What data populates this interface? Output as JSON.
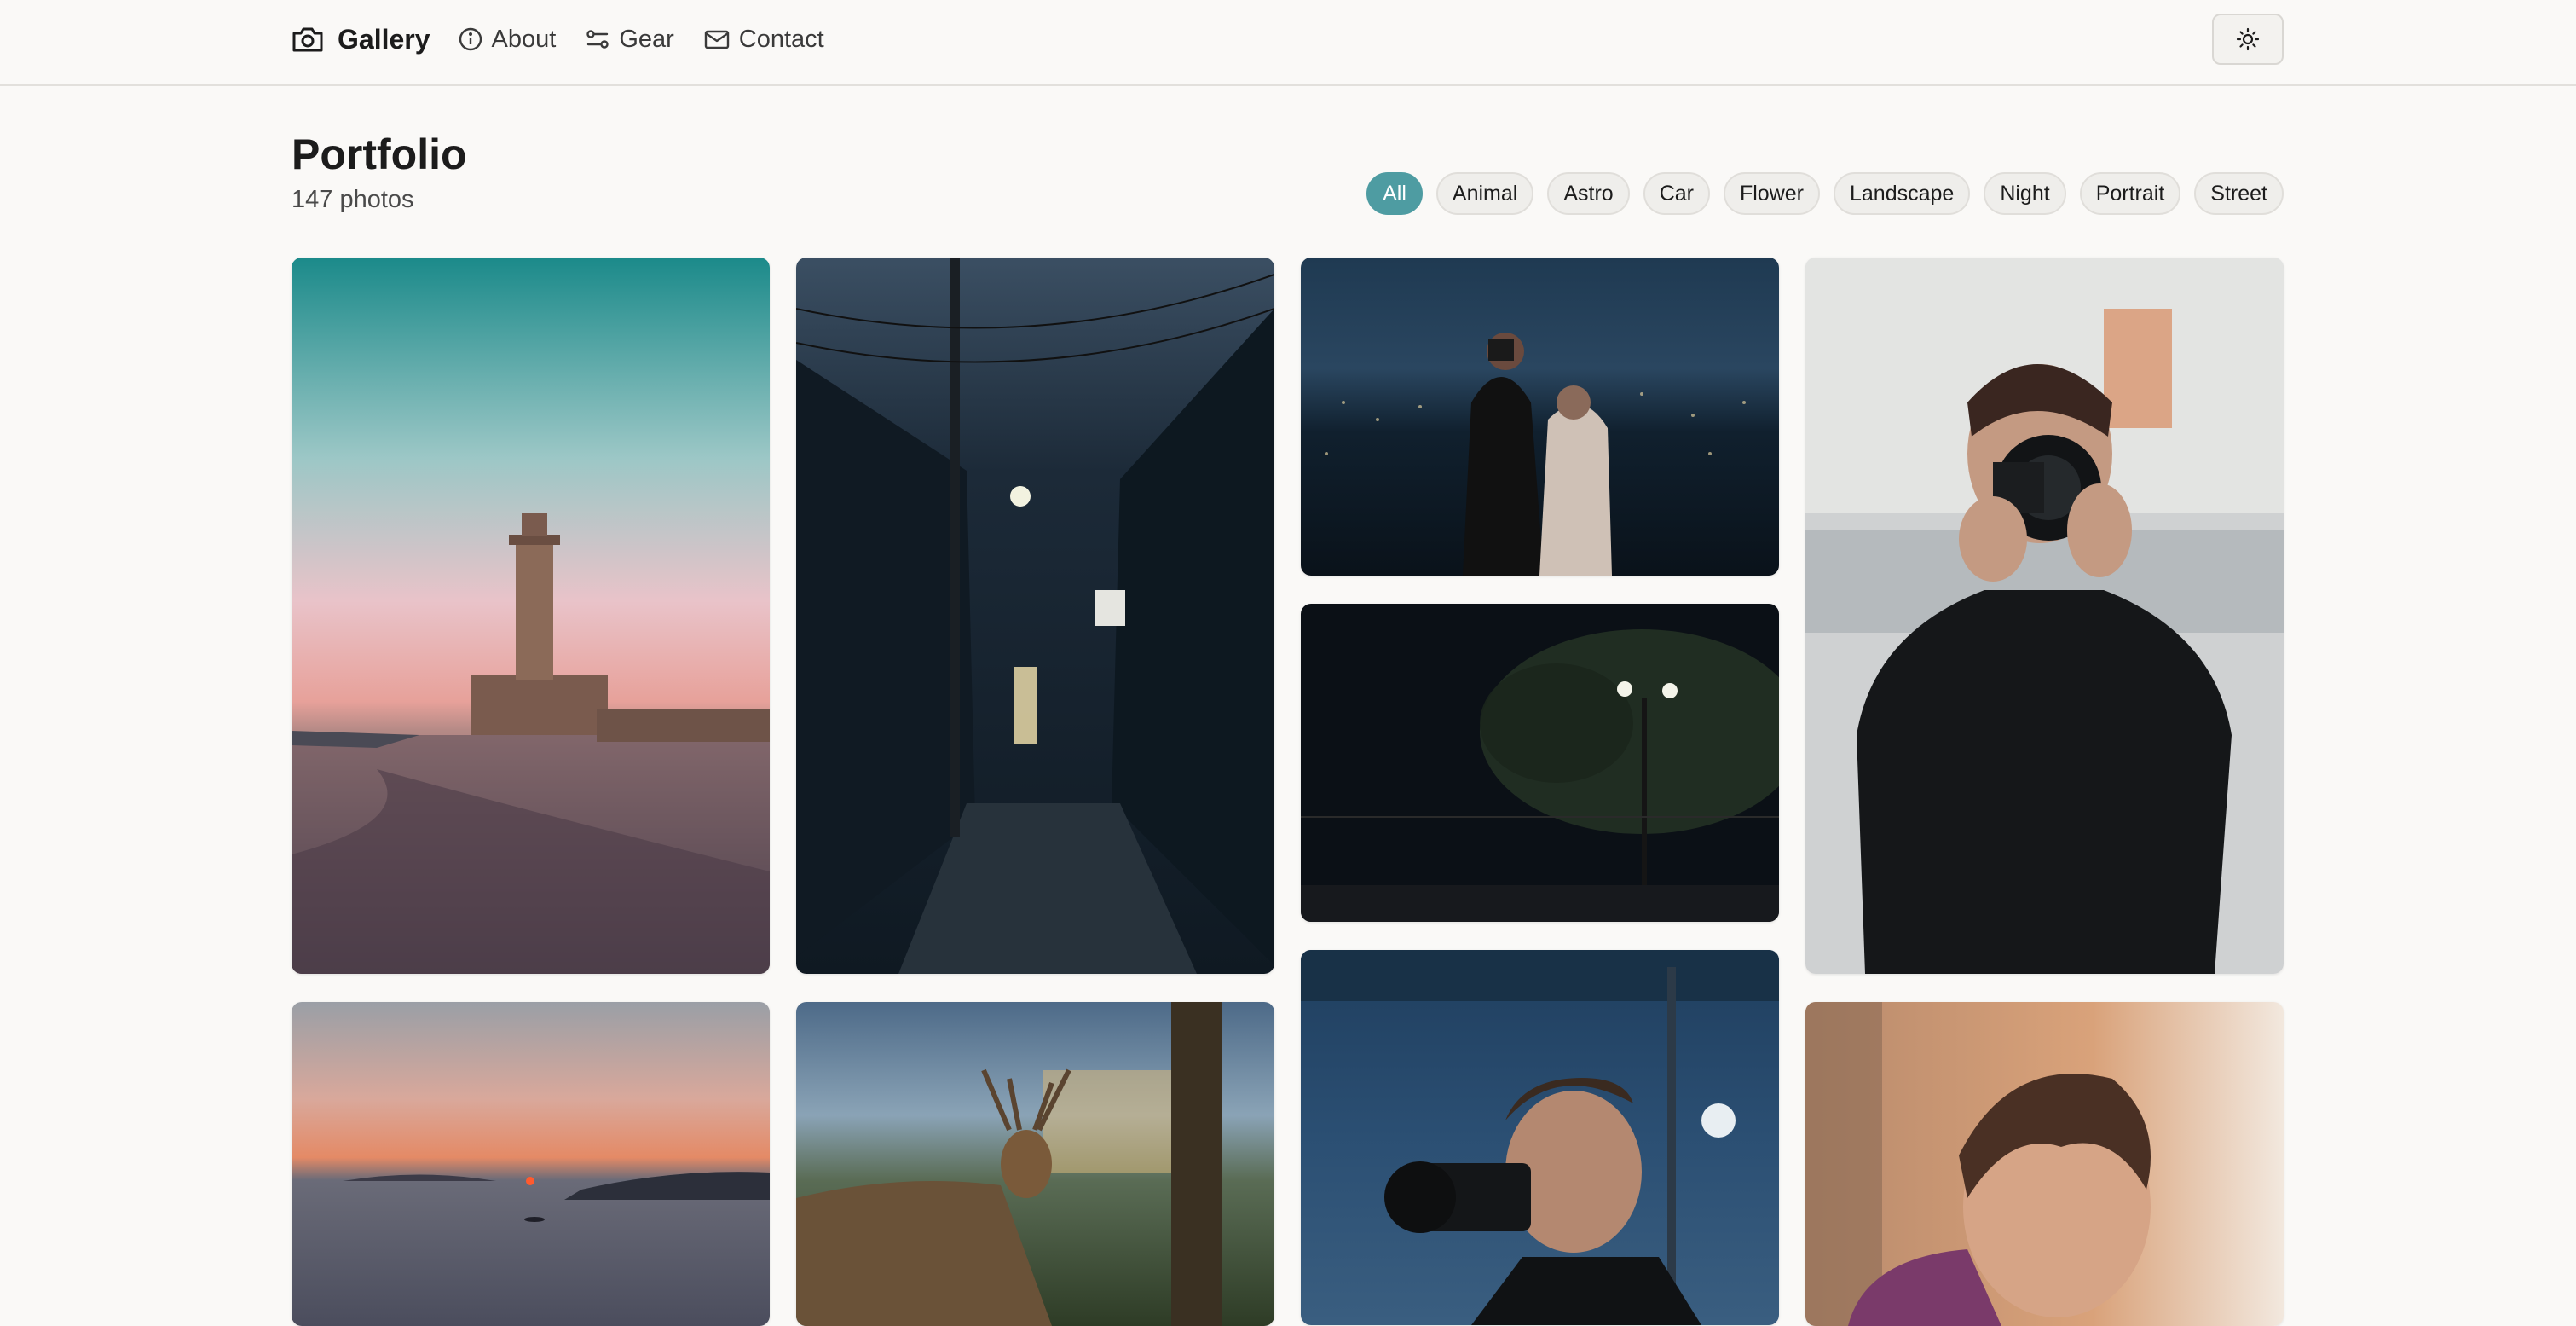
{
  "nav": {
    "brand": "Gallery",
    "links": [
      "About",
      "Gear",
      "Contact"
    ]
  },
  "theme_toggle": {
    "icon": "sun-icon"
  },
  "page": {
    "title": "Portfolio",
    "count": "147 photos"
  },
  "filters": [
    "All",
    "Animal",
    "Astro",
    "Car",
    "Flower",
    "Landscape",
    "Night",
    "Portrait",
    "Street"
  ],
  "active_filter": "All",
  "accent_color": "#4e9ca2",
  "photos": [
    "lighthouse sunset",
    "night alley street",
    "couple with camera city night",
    "trees lamp post night",
    "photographer portrait",
    "sea sunset",
    "deer",
    "photographer with camera",
    "man portrait"
  ]
}
